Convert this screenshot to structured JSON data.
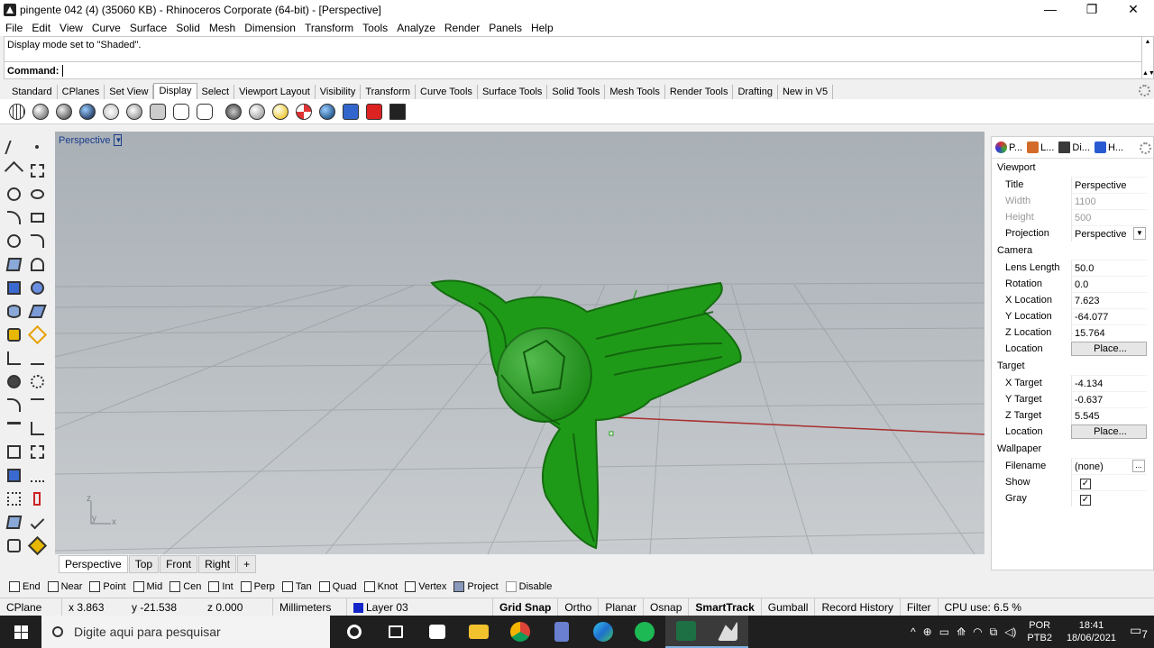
{
  "window": {
    "title": "pingente 042 (4) (35060 KB) - Rhinoceros Corporate (64-bit) - [Perspective]",
    "minimize": "—",
    "restore": "❐",
    "close": "✕"
  },
  "menu": [
    "File",
    "Edit",
    "View",
    "Curve",
    "Surface",
    "Solid",
    "Mesh",
    "Dimension",
    "Transform",
    "Tools",
    "Analyze",
    "Render",
    "Panels",
    "Help"
  ],
  "command": {
    "history": "Display mode set to \"Shaded\".",
    "prompt_label": "Command:",
    "value": ""
  },
  "toolbar_tabs": [
    "Standard",
    "CPlanes",
    "Set View",
    "Display",
    "Select",
    "Viewport Layout",
    "Visibility",
    "Transform",
    "Curve Tools",
    "Surface Tools",
    "Solid Tools",
    "Mesh Tools",
    "Render Tools",
    "Drafting",
    "New in V5"
  ],
  "active_toolbar_tab": "Display",
  "viewport": {
    "label": "Perspective",
    "axes": {
      "z": "z",
      "y": "y",
      "x": "x"
    }
  },
  "viewport_tabs": [
    "Perspective",
    "Top",
    "Front",
    "Right"
  ],
  "viewport_tab_add": "+",
  "panel_tabs": [
    {
      "label": "P...",
      "color": "#d23a2a"
    },
    {
      "label": "L...",
      "color": "#d26a2a"
    },
    {
      "label": "Di...",
      "color": "#3a3a3a"
    },
    {
      "label": "H...",
      "color": "#2a5ad2"
    }
  ],
  "properties": {
    "viewport_section": "Viewport",
    "title_label": "Title",
    "title_value": "Perspective",
    "width_label": "Width",
    "width_value": "1100",
    "height_label": "Height",
    "height_value": "500",
    "projection_label": "Projection",
    "projection_value": "Perspective",
    "camera_section": "Camera",
    "lens_label": "Lens Length",
    "lens_value": "50.0",
    "rotation_label": "Rotation",
    "rotation_value": "0.0",
    "xloc_label": "X Location",
    "xloc_value": "7.623",
    "yloc_label": "Y Location",
    "yloc_value": "-64.077",
    "zloc_label": "Z Location",
    "zloc_value": "15.764",
    "location_label": "Location",
    "place_button": "Place...",
    "target_section": "Target",
    "xtgt_label": "X Target",
    "xtgt_value": "-4.134",
    "ytgt_label": "Y Target",
    "ytgt_value": "-0.637",
    "ztgt_label": "Z Target",
    "ztgt_value": "5.545",
    "tloc_label": "Location",
    "tplace_button": "Place...",
    "wallpaper_section": "Wallpaper",
    "filename_label": "Filename",
    "filename_value": "(none)",
    "show_label": "Show",
    "gray_label": "Gray",
    "checkmark": "✓",
    "more": "..."
  },
  "osnaps": [
    {
      "label": "End",
      "checked": false
    },
    {
      "label": "Near",
      "checked": false
    },
    {
      "label": "Point",
      "checked": false
    },
    {
      "label": "Mid",
      "checked": false
    },
    {
      "label": "Cen",
      "checked": false
    },
    {
      "label": "Int",
      "checked": false
    },
    {
      "label": "Perp",
      "checked": false
    },
    {
      "label": "Tan",
      "checked": false
    },
    {
      "label": "Quad",
      "checked": false
    },
    {
      "label": "Knot",
      "checked": false
    },
    {
      "label": "Vertex",
      "checked": false
    },
    {
      "label": "Project",
      "checked": true
    },
    {
      "label": "Disable",
      "checked": false
    }
  ],
  "status": {
    "cplane": "CPlane",
    "x": "x 3.863",
    "y": "y -21.538",
    "z": "z 0.000",
    "units": "Millimeters",
    "layer": "Layer 03",
    "layer_color": "#1426c8",
    "grid_snap": "Grid Snap",
    "ortho": "Ortho",
    "planar": "Planar",
    "osnap": "Osnap",
    "smarttrack": "SmartTrack",
    "gumball": "Gumball",
    "record_history": "Record History",
    "filter": "Filter",
    "cpu": "CPU use: 6.5 %"
  },
  "taskbar": {
    "search_placeholder": "Digite aqui para pesquisar",
    "lang_top": "POR",
    "lang_bottom": "PTB2",
    "time": "18:41",
    "date": "18/06/2021",
    "notifications": "7"
  },
  "model_color": "#1f9a18"
}
